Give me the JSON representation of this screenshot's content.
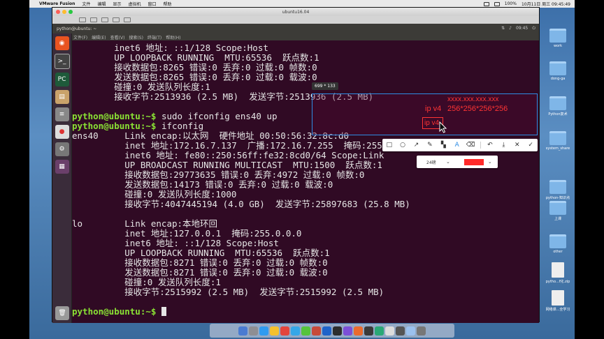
{
  "menubar": {
    "apple_glyph": "",
    "app_name": "VMware Fusion",
    "items": [
      "文件",
      "编辑",
      "显示",
      "虚拟机",
      "窗口",
      "帮助"
    ],
    "battery": "100%",
    "datetime": "10月11日 周三 09:45:49"
  },
  "vmware": {
    "title": "ubuntu16.04"
  },
  "ubuntu": {
    "window_title": "python@ubuntu: ~",
    "clock": "09:45",
    "menu": [
      "文件(F)",
      "编辑(E)",
      "查看(V)",
      "搜索(S)",
      "终端(T)",
      "帮助(H)"
    ]
  },
  "terminal": {
    "lines": [
      "        inet6 地址: ::1/128 Scope:Host",
      "        UP LOOPBACK RUNNING  MTU:65536  跃点数:1",
      "        接收数据包:8265 错误:0 丢弃:0 过载:0 帧数:0",
      "        发送数据包:8265 错误:0 丢弃:0 过载:0 载波:0",
      "        碰撞:0 发送队列长度:1",
      "        接收字节:2513936 (2.5 MB)  发送字节:2513936 (2.5 MB)",
      "",
      "",
      "ens40     Link encap:以太网  硬件地址 00:50:56:32:8c:d0",
      "          inet 地址:172.16.7.137  广播:172.16.7.255  掩码:255.255.255.0",
      "          inet6 地址: fe80::250:56ff:fe32:8cd0/64 Scope:Link",
      "          UP BROADCAST RUNNING MULTICAST  MTU:1500  跃点数:1",
      "          接收数据包:29773635 错误:0 丢弃:4972 过载:0 帧数:0",
      "          发送数据包:14173 错误:0 丢弃:0 过载:0 载波:0",
      "          碰撞:0 发送队列长度:1000",
      "          接收字节:4047445194 (4.0 GB)  发送字节:25897683 (25.8 MB)",
      "",
      "lo        Link encap:本地环回",
      "          inet 地址:127.0.0.1  掩码:255.0.0.0",
      "          inet6 地址: ::1/128 Scope:Host",
      "          UP LOOPBACK RUNNING  MTU:65536  跃点数:1",
      "          接收数据包:8271 错误:0 丢弃:0 过载:0 帧数:0",
      "          发送数据包:8271 错误:0 丢弃:0 过载:0 载波:0",
      "          碰撞:0 发送队列长度:1",
      "          接收字节:2515992 (2.5 MB)  发送字节:2515992 (2.5 MB)",
      ""
    ],
    "prompt": "python@ubuntu:~$",
    "cmd1": " sudo ifconfig ens40 up",
    "cmd2": " ifconfig",
    "final_prompt": "python@ubuntu:~$"
  },
  "snip": {
    "size_label": "699 * 133",
    "ann_xxx": "xxxx.xxx.xxx.xxx",
    "ann_ipv4": "ip v4",
    "ann_256": "256*256*256*256",
    "ann_ipv4_boxed": "ip v4",
    "font_size": "24磅",
    "color": "#ff2a2a"
  },
  "desktop": {
    "icons": [
      "work",
      "dong-ga",
      "Python复术",
      "system_share",
      "python-知识点",
      "上课",
      "other",
      "pytho...f化.zip",
      "网络课...全学习"
    ]
  }
}
